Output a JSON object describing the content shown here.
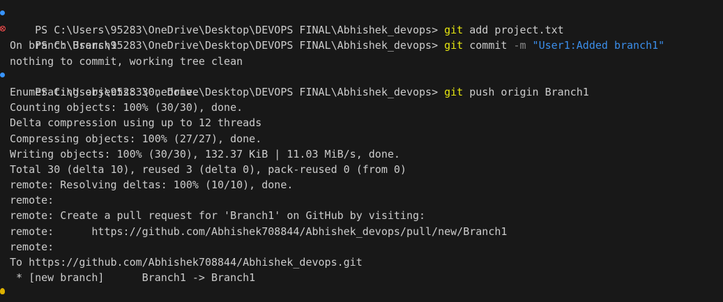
{
  "terminal": {
    "prompt": "PS C:\\Users\\95283\\OneDrive\\Desktop\\DEVOPS FINAL\\Abhishek_devops> ",
    "commands": [
      {
        "git": "git",
        "rest": " add project.txt"
      },
      {
        "git": "git",
        "rest": " commit ",
        "flag": "-m",
        "str": " \"User1:Added branch1\""
      },
      {
        "git": "git",
        "rest": " push origin Branch1"
      }
    ],
    "output": [
      "On branch Branch1",
      "nothing to commit, working tree clean",
      "Enumerating objects: 30, done.",
      "Counting objects: 100% (30/30), done.",
      "Delta compression using up to 12 threads",
      "Compressing objects: 100% (27/27), done.",
      "Writing objects: 100% (30/30), 132.37 KiB | 11.03 MiB/s, done.",
      "Total 30 (delta 10), reused 3 (delta 0), pack-reused 0 (from 0)",
      "remote: Resolving deltas: 100% (10/10), done.",
      "remote:",
      "remote: Create a pull request for 'Branch1' on GitHub by visiting:",
      "remote:      https://github.com/Abhishek708844/Abhishek_devops/pull/new/Branch1",
      "remote:",
      "To https://github.com/Abhishek708844/Abhishek_devops.git",
      " * [new branch]      Branch1 -> Branch1"
    ]
  },
  "colors": {
    "background": "#181818",
    "text": "#cccccc",
    "git_command": "#e5e510",
    "string": "#3b8eea",
    "success_marker": "#3794ff",
    "error_marker": "#f14c4c"
  }
}
